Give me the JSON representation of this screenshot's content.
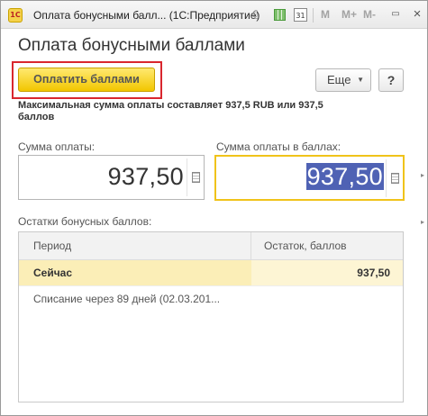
{
  "window": {
    "logo_text": "1C",
    "title": "Оплата бонусными балл... (1С:Предприятие)",
    "tb_letters": [
      "M",
      "M+",
      "M-"
    ],
    "calendar_day": "31"
  },
  "form": {
    "title": "Оплата бонусными баллами",
    "pay_button": "Оплатить баллами",
    "more_button": "Еще",
    "help_button": "?",
    "max_note": "Максимальная сумма оплаты составляет 937,5 RUB или 937,5 баллов"
  },
  "fields": {
    "sum_label": "Сумма оплаты:",
    "sum_value": "937,50",
    "points_label": "Сумма оплаты в баллах:",
    "points_value": "937,50"
  },
  "balances": {
    "label": "Остатки бонусных баллов:",
    "columns": [
      "Период",
      "Остаток, баллов"
    ],
    "rows": [
      {
        "period": "Сейчас",
        "rest": "937,50"
      },
      {
        "period": "Списание через 89 дней (02.03.201...",
        "rest": ""
      }
    ]
  },
  "colors": {
    "accent_yellow": "#f2c600",
    "highlight_red": "#d9272e",
    "selection_blue": "#4f62b4",
    "selected_row": "#fbeeb7"
  }
}
